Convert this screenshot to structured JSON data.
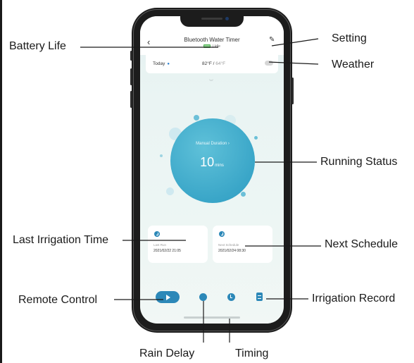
{
  "app": {
    "title": "Bluetooth Water Timer",
    "device_status": "Idle",
    "back_icon": "chevron-left-icon",
    "edit_icon": "pencil-icon"
  },
  "weather": {
    "day_label": "Today",
    "high_temp": "82°F",
    "separator": "/",
    "low_temp": "64°F",
    "condition_icon": "cloud-icon"
  },
  "running": {
    "label": "Manual Duration",
    "duration_value": "10",
    "duration_unit": "mins"
  },
  "cards": [
    {
      "label": "Last Run",
      "value": "2021/02/22 21:05",
      "icon": "clock-icon"
    },
    {
      "label": "Next Schedule",
      "value": "2021/02/24 08:30",
      "icon": "clock-icon"
    }
  ],
  "bottom_bar": {
    "remote_icon": "play-icon",
    "rain_delay_icon": "rain-icon",
    "timing_icon": "alarm-clock-icon",
    "record_icon": "document-icon"
  },
  "callouts": {
    "battery_life": "Battery Life",
    "setting": "Setting",
    "weather": "Weather",
    "running_status": "Running Status",
    "last_irrigation_time": "Last Irrigation Time",
    "next_schedule": "Next Schedule",
    "remote_control": "Remote Control",
    "irrigation_record": "Irrigation Record",
    "rain_delay": "Rain Delay",
    "timing": "Timing"
  },
  "colors": {
    "accent": "#2c88b8",
    "circle": "#45b1d0",
    "screen_bg": "#e9f4f3"
  }
}
